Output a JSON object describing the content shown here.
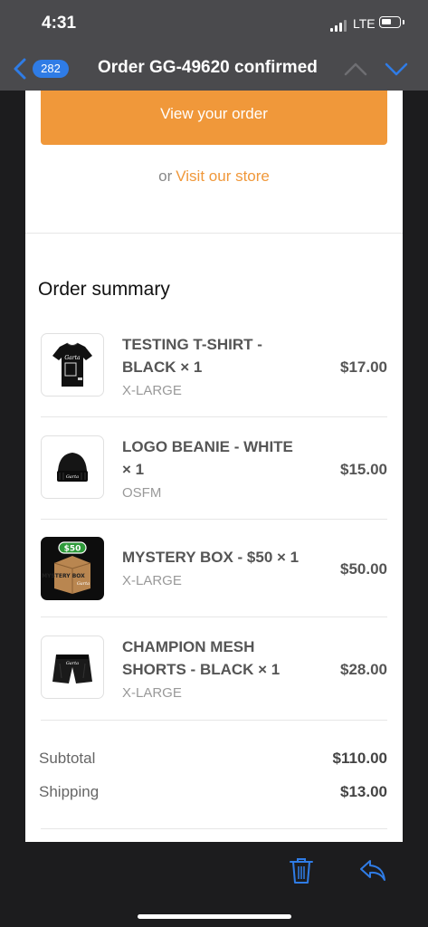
{
  "status": {
    "time": "4:31",
    "network": "LTE"
  },
  "nav": {
    "unread_count": "282",
    "title": "Order GG-49620 confirmed"
  },
  "email": {
    "view_order_button": "View your order",
    "visit_prefix": "or",
    "visit_link": "Visit our store",
    "summary_title": "Order summary",
    "items": [
      {
        "name": "TESTING T-SHIRT - BLACK × 1",
        "variant": "X-LARGE",
        "price": "$17.00",
        "icon": "tshirt-thumbnail"
      },
      {
        "name": "LOGO BEANIE - WHITE × 1",
        "variant": "OSFM",
        "price": "$15.00",
        "icon": "beanie-thumbnail"
      },
      {
        "name": "MYSTERY BOX - $50 × 1",
        "variant": "X-LARGE",
        "price": "$50.00",
        "icon": "mystery-box-thumbnail",
        "image_text": {
          "badge": "$50",
          "box": "MYSTERY BOX"
        }
      },
      {
        "name": "CHAMPION MESH SHORTS - BLACK × 1",
        "variant": "X-LARGE",
        "price": "$28.00",
        "icon": "shorts-thumbnail"
      }
    ],
    "subtotal_label": "Subtotal",
    "subtotal_value": "$110.00",
    "shipping_label": "Shipping",
    "shipping_value": "$13.00"
  },
  "colors": {
    "accent": "#f0983a",
    "ios_blue": "#2f7ce6",
    "bar": "#4a4a4d",
    "dark": "#1c1c1e"
  },
  "toolbar": {
    "icons": [
      "trash-icon",
      "reply-icon"
    ]
  }
}
